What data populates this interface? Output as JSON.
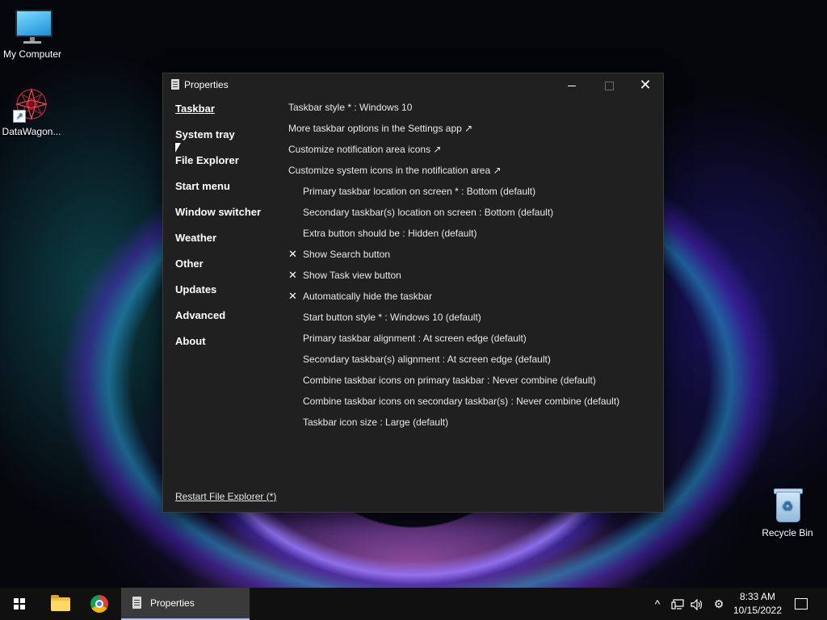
{
  "desktop": {
    "icons": [
      {
        "label": "My Computer",
        "icon": "monitor-icon"
      },
      {
        "label": "DataWagon...",
        "icon": "star-shortcut-icon"
      },
      {
        "label": "Recycle Bin",
        "icon": "recycle-bin-icon"
      }
    ]
  },
  "window": {
    "title": "Properties",
    "nav": [
      {
        "label": "Taskbar",
        "active": true
      },
      {
        "label": "System tray"
      },
      {
        "label": "File Explorer"
      },
      {
        "label": "Start menu"
      },
      {
        "label": "Window switcher"
      },
      {
        "label": "Weather"
      },
      {
        "label": "Other"
      },
      {
        "label": "Updates"
      },
      {
        "label": "Advanced"
      },
      {
        "label": "About"
      }
    ],
    "settings": [
      {
        "text": "Taskbar style * : Windows 10"
      },
      {
        "text": "More taskbar options in the Settings app ↗"
      },
      {
        "text": "Customize notification area icons ↗"
      },
      {
        "text": "Customize system icons in the notification area ↗"
      },
      {
        "text": "Primary taskbar location on screen * : Bottom (default)"
      },
      {
        "text": "Secondary taskbar(s) location on screen : Bottom (default)"
      },
      {
        "text": "Extra button should be : Hidden (default)"
      },
      {
        "text": "Show Search button",
        "check": "✕"
      },
      {
        "text": "Show Task view button",
        "check": "✕"
      },
      {
        "text": "Automatically hide the taskbar",
        "check": "✕"
      },
      {
        "text": "Start button style * : Windows 10 (default)"
      },
      {
        "text": "Primary taskbar alignment : At screen edge (default)"
      },
      {
        "text": "Secondary taskbar(s) alignment : At screen edge (default)"
      },
      {
        "text": "Combine taskbar icons on primary taskbar : Never combine (default)"
      },
      {
        "text": "Combine taskbar icons on secondary taskbar(s) : Never combine (default)"
      },
      {
        "text": "Taskbar icon size : Large (default)"
      }
    ],
    "restart_link": "Restart File Explorer (*)"
  },
  "taskbar": {
    "active_app_label": "Properties",
    "clock_time": "8:33 AM",
    "clock_date": "10/15/2022",
    "tray_chevron": "^",
    "accent": "#b8b8ff"
  }
}
